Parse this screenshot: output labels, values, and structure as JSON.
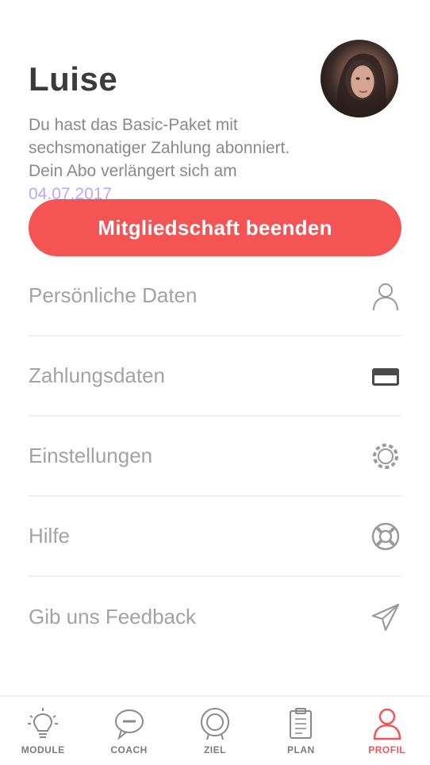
{
  "profile": {
    "name": "Luise",
    "subscription_text": "Du hast das Basic-Paket mit sechsmonatiger Zahlung abonniert. Dein Abo verlängert sich am ",
    "renewal_date": "04.07.2017",
    "avatar_icon": "user-photo"
  },
  "actions": {
    "end_membership_label": "Mitgliedschaft beenden",
    "button_color": "#f45554"
  },
  "menu": {
    "items": [
      {
        "label": "Persönliche Daten",
        "icon": "person-icon"
      },
      {
        "label": "Zahlungsdaten",
        "icon": "credit-card-icon"
      },
      {
        "label": "Einstellungen",
        "icon": "gear-icon"
      },
      {
        "label": "Hilfe",
        "icon": "lifebuoy-icon"
      },
      {
        "label": "Gib uns Feedback",
        "icon": "paper-plane-icon"
      }
    ]
  },
  "bottom_nav": {
    "items": [
      {
        "label": "MODULE",
        "icon": "lightbulb-icon",
        "active": false
      },
      {
        "label": "COACH",
        "icon": "chat-bubble-icon",
        "active": false
      },
      {
        "label": "ZIEL",
        "icon": "target-icon",
        "active": false
      },
      {
        "label": "PLAN",
        "icon": "clipboard-icon",
        "active": false
      },
      {
        "label": "PROFIL",
        "icon": "person-icon",
        "active": true
      }
    ],
    "active_color": "#f45554"
  }
}
